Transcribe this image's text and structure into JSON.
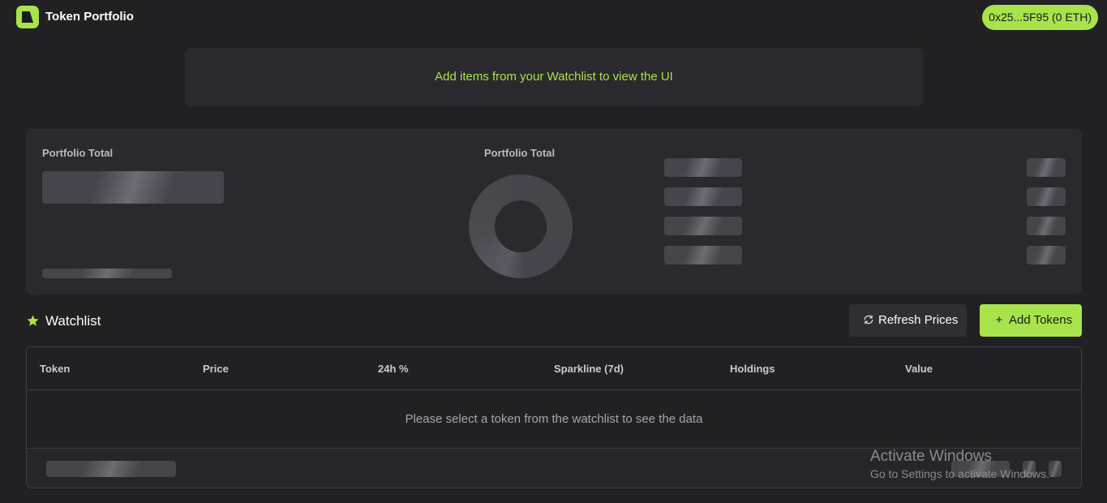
{
  "header": {
    "app_title": "Token Portfolio",
    "wallet_label": "0x25...5F95 (0 ETH)",
    "accent_color": "#a9e34b"
  },
  "notice": {
    "text": "Add items from your Watchlist to view the UI"
  },
  "portfolio": {
    "left_label": "Portfolio Total",
    "chart_label": "Portfolio Total"
  },
  "watchlist": {
    "title": "Watchlist",
    "refresh_label": "Refresh Prices",
    "add_label": "Add Tokens",
    "columns": [
      "Token",
      "Price",
      "24h %",
      "Sparkline (7d)",
      "Holdings",
      "Value"
    ],
    "empty_message": "Please select a token from the watchlist to see the data"
  },
  "watermark": {
    "title": "Activate Windows",
    "subtitle": "Go to Settings to activate Windows."
  },
  "icons": {
    "logo": "logo-icon",
    "star": "star-icon",
    "refresh": "refresh-icon",
    "plus": "plus-icon"
  }
}
